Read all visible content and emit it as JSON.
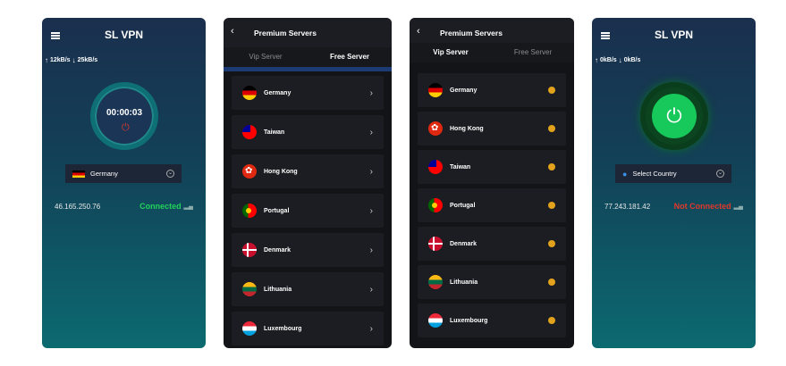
{
  "screen1": {
    "title": "SL VPN",
    "up_speed": "12kB/s",
    "down_speed": "25kB/s",
    "timer": "00:00:03",
    "selected_country": "Germany",
    "ip": "46.165.250.76",
    "status": "Connected"
  },
  "screen2": {
    "title": "Premium Servers",
    "tabs": [
      "Vip Server",
      "Free Server"
    ],
    "active_tab": "Free Server",
    "servers": [
      "Germany",
      "Taiwan",
      "Hong Kong",
      "Portugal",
      "Denmark",
      "Lithuania",
      "Luxembourg"
    ]
  },
  "screen3": {
    "title": "Premium Servers",
    "tabs": [
      "Vip Server",
      "Free Server"
    ],
    "active_tab": "Vip Server",
    "servers": [
      "Germany",
      "Hong Kong",
      "Taiwan",
      "Portugal",
      "Denmark",
      "Lithuania",
      "Luxembourg"
    ]
  },
  "screen4": {
    "title": "SL VPN",
    "up_speed": "0kB/s",
    "down_speed": "0kB/s",
    "selected_country": "Select Country",
    "ip": "77.243.181.42",
    "status": "Not Connected"
  },
  "colors": {
    "connected": "#21d15b",
    "not_connected": "#e0382a",
    "vip_dot": "#e3a21b",
    "power_button": "#17c95a"
  }
}
